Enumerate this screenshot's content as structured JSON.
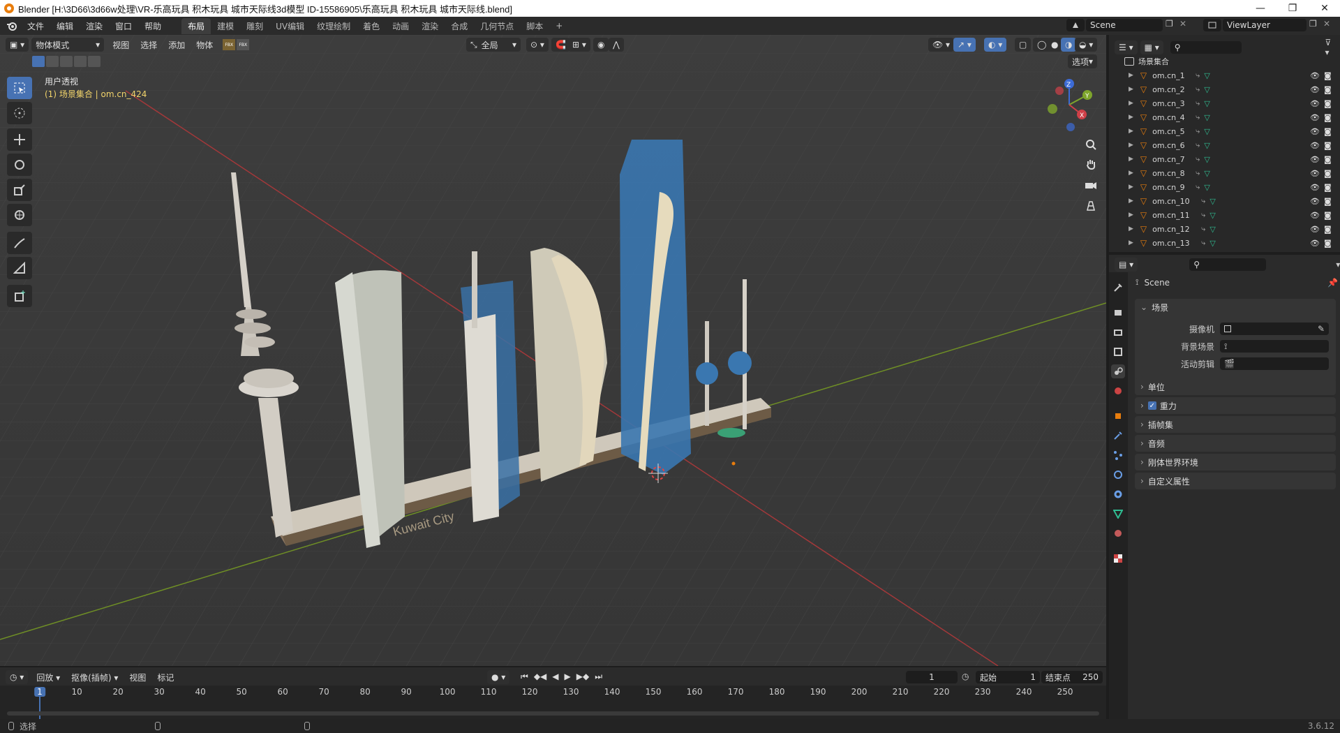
{
  "titlebar": {
    "title": "Blender [H:\\3D66\\3d66w处理\\VR-乐高玩具 积木玩具 城市天际线3d模型 ID-15586905\\乐高玩具 积木玩具 城市天际线.blend]",
    "min": "—",
    "restore": "❐",
    "close": "✕"
  },
  "menubar": {
    "menus": [
      "文件",
      "编辑",
      "渲染",
      "窗口",
      "帮助"
    ],
    "workspaces": [
      "布局",
      "建模",
      "雕刻",
      "UV编辑",
      "纹理绘制",
      "着色",
      "动画",
      "渲染",
      "合成",
      "几何节点",
      "脚本"
    ],
    "active_workspace": "布局",
    "add_tab": "+",
    "scene": "Scene",
    "view_layer": "ViewLayer"
  },
  "viewport_header": {
    "mode": "物体模式",
    "menus": [
      "视图",
      "选择",
      "添加",
      "物体"
    ],
    "transform_orientation": "全局",
    "options": "选项",
    "fbx1": "FBX",
    "fbx2": "FBX"
  },
  "viewport": {
    "view_name": "用户透视",
    "context": "(1) 场景集合 | om.cn_424",
    "base_label": "Kuwait City",
    "gizmo": {
      "z": "Z",
      "y": "Y",
      "x": "X"
    }
  },
  "outliner": {
    "collection": "场景集合",
    "items": [
      "om.cn_1",
      "om.cn_2",
      "om.cn_3",
      "om.cn_4",
      "om.cn_5",
      "om.cn_6",
      "om.cn_7",
      "om.cn_8",
      "om.cn_9",
      "om.cn_10",
      "om.cn_11",
      "om.cn_12",
      "om.cn_13"
    ]
  },
  "properties": {
    "scene_name": "Scene",
    "section_scene": "场景",
    "camera_label": "摄像机",
    "background_label": "背景场景",
    "active_clip_label": "活动剪辑",
    "panels": [
      "单位",
      "重力",
      "插帧集",
      "音频",
      "刚体世界环境",
      "自定义属性"
    ],
    "gravity_checked": true
  },
  "timeline": {
    "menus": [
      "回放",
      "抠像(插帧)",
      "视图",
      "标记"
    ],
    "current_frame": "1",
    "start_label": "起始",
    "start": "1",
    "end_label": "结束点",
    "end": "250",
    "ticks": [
      "1",
      "10",
      "20",
      "30",
      "40",
      "50",
      "60",
      "70",
      "80",
      "90",
      "100",
      "110",
      "120",
      "130",
      "140",
      "150",
      "160",
      "170",
      "180",
      "190",
      "200",
      "210",
      "220",
      "230",
      "240",
      "250"
    ]
  },
  "statusbar": {
    "select": "选择",
    "version": "3.6.12"
  },
  "colors": {
    "accent": "#4772b3",
    "object_orange": "#e87d0d",
    "mesh_green": "#2fbc91",
    "grid_red": "#b93e3e",
    "grid_green": "#7b9b2c"
  }
}
